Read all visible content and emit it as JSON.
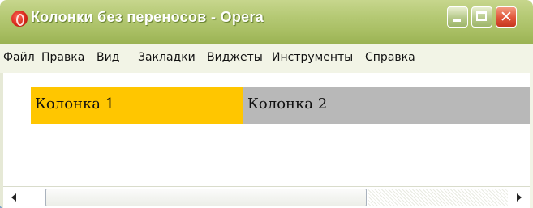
{
  "window": {
    "title": "Колонки без переносов - Opera",
    "icon": "opera-logo-icon",
    "controls": {
      "minimize": "minimize-icon",
      "maximize": "maximize-icon",
      "close": "close-icon",
      "close_glyph": "✕"
    },
    "colors": {
      "titlebar": "#a9bf64",
      "close_button": "#e0553a"
    }
  },
  "menu": {
    "items": [
      "Файл",
      "Правка",
      "Вид",
      "Закладки",
      "Виджеты",
      "Инструменты",
      "Справка"
    ]
  },
  "page": {
    "columns": [
      {
        "label": "Колонка 1",
        "color": "#ffc600"
      },
      {
        "label": "Колонка 2",
        "color": "#b8b8b8"
      }
    ]
  },
  "scrollbar": {
    "left_arrow": "scroll-left-arrow-icon",
    "right_arrow": "scroll-right-arrow-icon"
  }
}
